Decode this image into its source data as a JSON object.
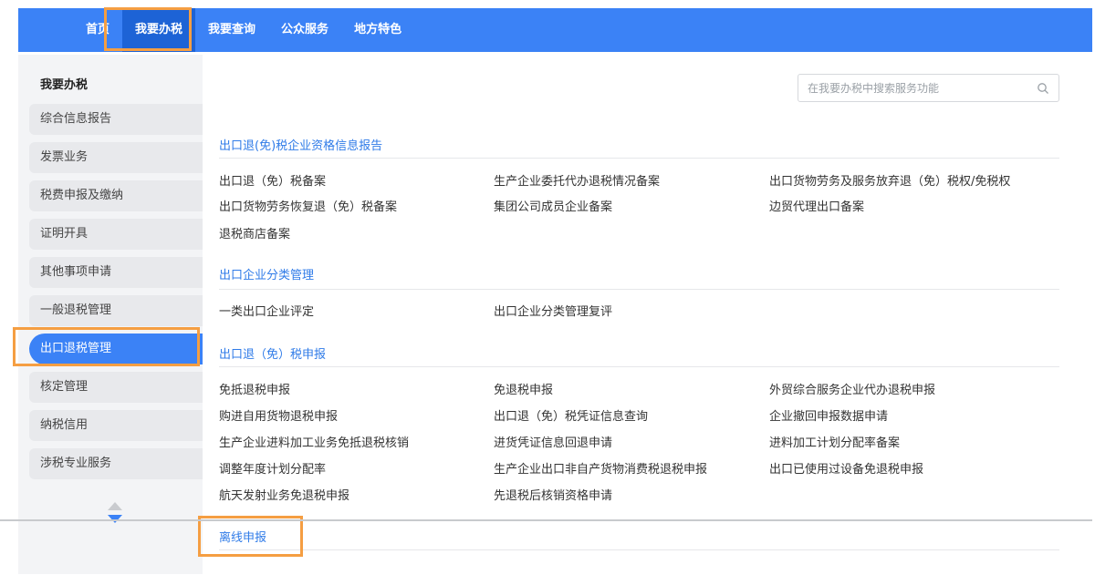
{
  "topnav": {
    "items": [
      "首页",
      "我要办税",
      "我要查询",
      "公众服务",
      "地方特色"
    ],
    "active": "我要办税"
  },
  "sidebar": {
    "title": "我要办税",
    "items": [
      "综合信息报告",
      "发票业务",
      "税费申报及缴纳",
      "证明开具",
      "其他事项申请",
      "一般退税管理",
      "出口退税管理",
      "核定管理",
      "纳税信用",
      "涉税专业服务"
    ],
    "active": "出口退税管理"
  },
  "search": {
    "placeholder": "在我要办税中搜索服务功能",
    "icon": "search-icon"
  },
  "sections": [
    {
      "title": "出口退(免)税企业资格信息报告",
      "links": [
        "出口退（免）税备案",
        "生产企业委托代办退税情况备案",
        "出口货物劳务及服务放弃退（免）税权/免税权",
        "出口货物劳务恢复退（免）税备案",
        "集团公司成员企业备案",
        "边贸代理出口备案",
        "退税商店备案"
      ]
    },
    {
      "title": "出口企业分类管理",
      "links": [
        "一类出口企业评定",
        "出口企业分类管理复评"
      ]
    },
    {
      "title": "出口退（免）税申报",
      "links": [
        "免抵退税申报",
        "免退税申报",
        "外贸综合服务企业代办退税申报",
        "购进自用货物退税申报",
        "出口退（免）税凭证信息查询",
        "企业撤回申报数据申请",
        "生产企业进料加工业务免抵退税核销",
        "进货凭证信息回退申请",
        "进料加工计划分配率备案",
        "调整年度计划分配率",
        "生产企业出口非自产货物消费税退税申报",
        "出口已使用过设备免退税申报",
        "航天发射业务免退税申报",
        "先退税后核销资格申请"
      ]
    },
    {
      "title": "离线申报",
      "links": []
    }
  ],
  "colors": {
    "accent": "#3b82f6",
    "link": "#2f7be8",
    "highlight": "#f59e42"
  }
}
